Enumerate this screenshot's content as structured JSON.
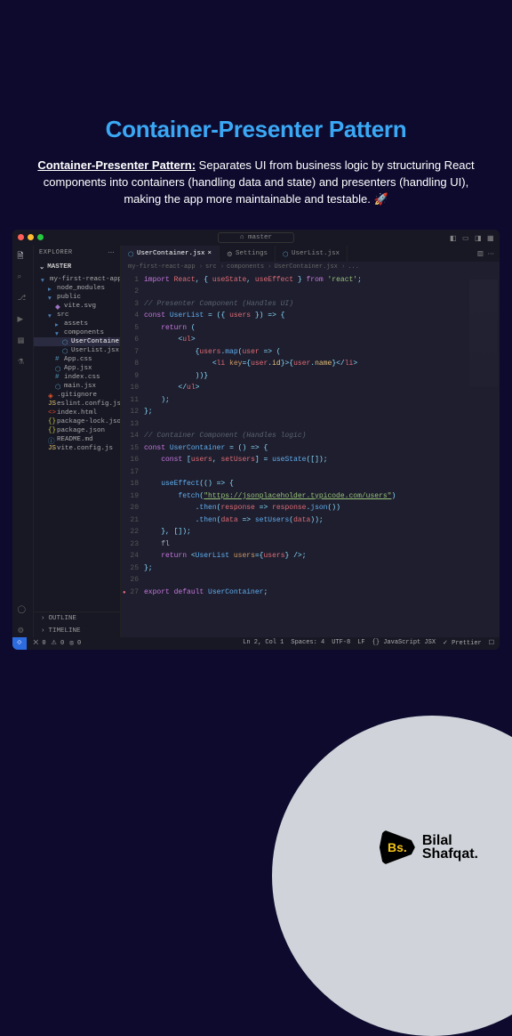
{
  "hero": {
    "title": "Container-Presenter Pattern",
    "lead": "Container-Presenter Pattern:",
    "desc": " Separates UI from business logic by structuring React components into containers (handling data and state) and presenters (handling UI), making the app more maintainable and testable. 🚀"
  },
  "titlebar": {
    "branch_prefix": "⌂",
    "branch": "master"
  },
  "activitybar": {
    "icons": [
      "files",
      "search",
      "git",
      "debug",
      "extensions",
      "beaker"
    ],
    "bottom": [
      "account",
      "settings"
    ]
  },
  "sidebar": {
    "header": "EXPLORER",
    "workspace": "MASTER",
    "tree": [
      {
        "indent": 0,
        "icon": "folder",
        "label": "my-first-react-app",
        "expand": true
      },
      {
        "indent": 1,
        "icon": "folder",
        "label": "node_modules",
        "expand": false
      },
      {
        "indent": 1,
        "icon": "folder",
        "label": "public",
        "expand": true
      },
      {
        "indent": 2,
        "icon": "svg",
        "label": "vite.svg"
      },
      {
        "indent": 1,
        "icon": "folder",
        "label": "src",
        "expand": true
      },
      {
        "indent": 2,
        "icon": "folder",
        "label": "assets",
        "expand": false
      },
      {
        "indent": 2,
        "icon": "folder",
        "label": "components",
        "expand": true
      },
      {
        "indent": 3,
        "icon": "react",
        "label": "UserContainer.jsx",
        "selected": true
      },
      {
        "indent": 3,
        "icon": "react",
        "label": "UserList.jsx"
      },
      {
        "indent": 2,
        "icon": "css",
        "label": "App.css"
      },
      {
        "indent": 2,
        "icon": "react",
        "label": "App.jsx"
      },
      {
        "indent": 2,
        "icon": "css",
        "label": "index.css"
      },
      {
        "indent": 2,
        "icon": "react",
        "label": "main.jsx"
      },
      {
        "indent": 1,
        "icon": "git",
        "label": ".gitignore"
      },
      {
        "indent": 1,
        "icon": "js",
        "label": "eslint.config.js"
      },
      {
        "indent": 1,
        "icon": "html",
        "label": "index.html"
      },
      {
        "indent": 1,
        "icon": "json",
        "label": "package-lock.json"
      },
      {
        "indent": 1,
        "icon": "json",
        "label": "package.json"
      },
      {
        "indent": 1,
        "icon": "md",
        "label": "README.md"
      },
      {
        "indent": 1,
        "icon": "js",
        "label": "vite.config.js"
      }
    ],
    "bottom": [
      "OUTLINE",
      "TIMELINE"
    ]
  },
  "tabs": [
    {
      "icon": "react",
      "label": "UserContainer.jsx",
      "active": true,
      "dirty": true
    },
    {
      "icon": "settings",
      "label": "Settings",
      "active": false
    },
    {
      "icon": "react",
      "label": "UserList.jsx",
      "active": false
    }
  ],
  "breadcrumb": [
    "my-first-react-app",
    "src",
    "components",
    "UserContainer.jsx",
    "..."
  ],
  "code": {
    "lines": [
      {
        "n": 1,
        "tokens": [
          [
            "kw",
            "import"
          ],
          [
            "plain",
            " "
          ],
          [
            "var",
            "React"
          ],
          [
            "punc",
            ", { "
          ],
          [
            "var",
            "useState"
          ],
          [
            "punc",
            ", "
          ],
          [
            "var",
            "useEffect"
          ],
          [
            "punc",
            " } "
          ],
          [
            "kw",
            "from"
          ],
          [
            "plain",
            " "
          ],
          [
            "str2",
            "'react'"
          ],
          [
            "punc",
            ";"
          ]
        ]
      },
      {
        "n": 2,
        "tokens": []
      },
      {
        "n": 3,
        "tokens": [
          [
            "cmt",
            "// Presenter Component (Handles UI)"
          ]
        ]
      },
      {
        "n": 4,
        "tokens": [
          [
            "kw",
            "const"
          ],
          [
            "plain",
            " "
          ],
          [
            "fn",
            "UserList"
          ],
          [
            "plain",
            " "
          ],
          [
            "punc",
            "= ({ "
          ],
          [
            "var",
            "users"
          ],
          [
            "punc",
            " }) => {"
          ]
        ]
      },
      {
        "n": 5,
        "tokens": [
          [
            "plain",
            "    "
          ],
          [
            "kw",
            "return"
          ],
          [
            "plain",
            " "
          ],
          [
            "punc",
            "("
          ]
        ]
      },
      {
        "n": 6,
        "tokens": [
          [
            "plain",
            "        "
          ],
          [
            "punc",
            "<"
          ],
          [
            "tag",
            "ul"
          ],
          [
            "punc",
            ">"
          ]
        ]
      },
      {
        "n": 7,
        "tokens": [
          [
            "plain",
            "            "
          ],
          [
            "punc",
            "{"
          ],
          [
            "var",
            "users"
          ],
          [
            "punc",
            "."
          ],
          [
            "fn",
            "map"
          ],
          [
            "punc",
            "("
          ],
          [
            "var",
            "user"
          ],
          [
            "plain",
            " "
          ],
          [
            "punc",
            "=> ("
          ]
        ]
      },
      {
        "n": 8,
        "tokens": [
          [
            "plain",
            "                "
          ],
          [
            "punc",
            "<"
          ],
          [
            "tag",
            "li"
          ],
          [
            "plain",
            " "
          ],
          [
            "attr",
            "key"
          ],
          [
            "punc",
            "={"
          ],
          [
            "var",
            "user"
          ],
          [
            "punc",
            "."
          ],
          [
            "prop",
            "id"
          ],
          [
            "punc",
            "}>{"
          ],
          [
            "var",
            "user"
          ],
          [
            "punc",
            "."
          ],
          [
            "prop",
            "name"
          ],
          [
            "punc",
            "}</"
          ],
          [
            "tag",
            "li"
          ],
          [
            "punc",
            ">"
          ]
        ]
      },
      {
        "n": 9,
        "tokens": [
          [
            "plain",
            "            "
          ],
          [
            "punc",
            "))}"
          ]
        ]
      },
      {
        "n": 10,
        "tokens": [
          [
            "plain",
            "        "
          ],
          [
            "punc",
            "</"
          ],
          [
            "tag",
            "ul"
          ],
          [
            "punc",
            ">"
          ]
        ]
      },
      {
        "n": 11,
        "tokens": [
          [
            "plain",
            "    "
          ],
          [
            "punc",
            ");"
          ]
        ]
      },
      {
        "n": 12,
        "tokens": [
          [
            "punc",
            "};"
          ]
        ]
      },
      {
        "n": 13,
        "tokens": []
      },
      {
        "n": 14,
        "tokens": [
          [
            "cmt",
            "// Container Component (Handles logic)"
          ]
        ]
      },
      {
        "n": 15,
        "tokens": [
          [
            "kw",
            "const"
          ],
          [
            "plain",
            " "
          ],
          [
            "fn",
            "UserContainer"
          ],
          [
            "plain",
            " "
          ],
          [
            "punc",
            "= () => {"
          ]
        ]
      },
      {
        "n": 16,
        "tokens": [
          [
            "plain",
            "    "
          ],
          [
            "kw",
            "const"
          ],
          [
            "plain",
            " "
          ],
          [
            "punc",
            "["
          ],
          [
            "var",
            "users"
          ],
          [
            "punc",
            ", "
          ],
          [
            "var",
            "setUsers"
          ],
          [
            "punc",
            "] = "
          ],
          [
            "fn",
            "useState"
          ],
          [
            "punc",
            "([]);"
          ]
        ]
      },
      {
        "n": 17,
        "tokens": []
      },
      {
        "n": 18,
        "tokens": [
          [
            "plain",
            "    "
          ],
          [
            "fn",
            "useEffect"
          ],
          [
            "punc",
            "(() => {"
          ]
        ]
      },
      {
        "n": 19,
        "tokens": [
          [
            "plain",
            "        "
          ],
          [
            "fn",
            "fetch"
          ],
          [
            "punc",
            "("
          ],
          [
            "str",
            "\"https://jsonplaceholder.typicode.com/users\""
          ],
          [
            "punc",
            ")"
          ]
        ]
      },
      {
        "n": 20,
        "tokens": [
          [
            "plain",
            "            "
          ],
          [
            "punc",
            "."
          ],
          [
            "fn",
            "then"
          ],
          [
            "punc",
            "("
          ],
          [
            "var",
            "response"
          ],
          [
            "plain",
            " "
          ],
          [
            "punc",
            "=> "
          ],
          [
            "var",
            "response"
          ],
          [
            "punc",
            "."
          ],
          [
            "fn",
            "json"
          ],
          [
            "punc",
            "())"
          ]
        ]
      },
      {
        "n": 21,
        "tokens": [
          [
            "plain",
            "            "
          ],
          [
            "punc",
            "."
          ],
          [
            "fn",
            "then"
          ],
          [
            "punc",
            "("
          ],
          [
            "var",
            "data"
          ],
          [
            "plain",
            " "
          ],
          [
            "punc",
            "=> "
          ],
          [
            "fn",
            "setUsers"
          ],
          [
            "punc",
            "("
          ],
          [
            "var",
            "data"
          ],
          [
            "punc",
            "));"
          ]
        ]
      },
      {
        "n": 22,
        "tokens": [
          [
            "plain",
            "    "
          ],
          [
            "punc",
            "}, []);"
          ]
        ]
      },
      {
        "n": 23,
        "tokens": [
          [
            "plain",
            "    "
          ],
          [
            "plain",
            "fl"
          ]
        ]
      },
      {
        "n": 24,
        "tokens": [
          [
            "plain",
            "    "
          ],
          [
            "kw",
            "return"
          ],
          [
            "plain",
            " "
          ],
          [
            "punc",
            "<"
          ],
          [
            "fn",
            "UserList"
          ],
          [
            "plain",
            " "
          ],
          [
            "attr",
            "users"
          ],
          [
            "punc",
            "={"
          ],
          [
            "var",
            "users"
          ],
          [
            "punc",
            "} />;"
          ]
        ]
      },
      {
        "n": 25,
        "tokens": [
          [
            "punc",
            "};"
          ]
        ]
      },
      {
        "n": 26,
        "tokens": []
      },
      {
        "n": 27,
        "marker": true,
        "tokens": [
          [
            "kw",
            "export"
          ],
          [
            "plain",
            " "
          ],
          [
            "kw",
            "default"
          ],
          [
            "plain",
            " "
          ],
          [
            "fn",
            "UserContainer"
          ],
          [
            "punc",
            ";"
          ]
        ]
      }
    ]
  },
  "statusbar": {
    "left": [
      "⨉ 0",
      "⚠ 0",
      "⦻ 0"
    ],
    "right": [
      "Ln 2, Col 1",
      "Spaces: 4",
      "UTF-8",
      "LF",
      "{} JavaScript JSX",
      "✓ Prettier",
      "☐"
    ]
  },
  "footer": {
    "logo_short": "Bs.",
    "name_line1": "Bilal",
    "name_line2": "Shafqat."
  }
}
